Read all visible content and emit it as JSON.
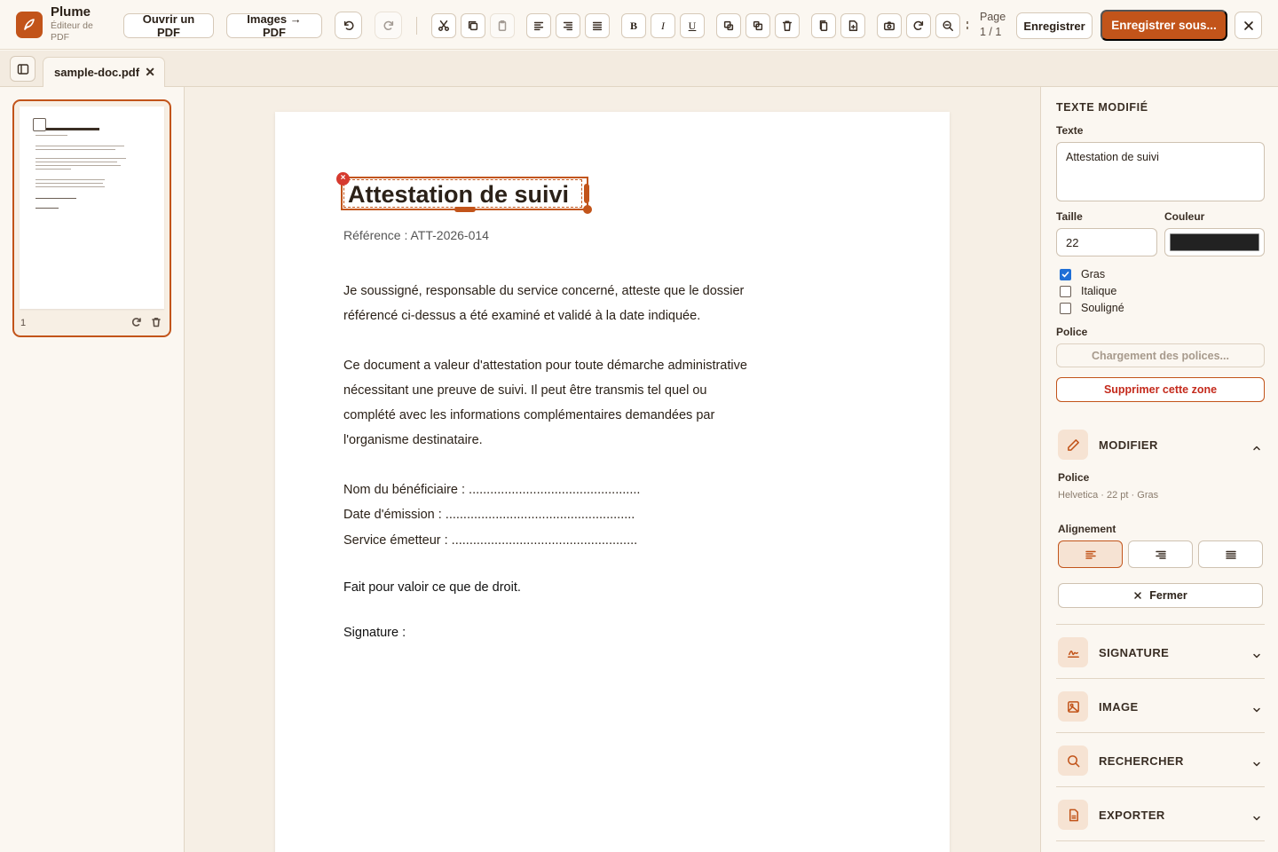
{
  "app": {
    "name": "Plume",
    "subtitle": "Éditeur de PDF"
  },
  "toolbar": {
    "open_pdf": "Ouvrir un PDF",
    "images_to_pdf": "Images → PDF",
    "bold_glyph": "B",
    "italic_glyph": "I",
    "underline_glyph": "U",
    "page_label": "Page",
    "page_value": "1 / 1",
    "save": "Enregistrer",
    "save_as": "Enregistrer sous..."
  },
  "tabs": [
    {
      "label": "sample-doc.pdf",
      "close": "✕"
    }
  ],
  "thumbnails": [
    {
      "page_number": "1"
    }
  ],
  "document": {
    "title": "Attestation de suivi",
    "reference": "Référence : ATT-2026-014",
    "para1_line1": "Je soussigné, responsable du service concerné, atteste que le dossier",
    "para1_line2": "référencé ci-dessus a été examiné et validé à la date indiquée.",
    "para2_line1": "Ce document a valeur d'attestation pour toute démarche administrative",
    "para2_line2": "nécessitant une preuve de suivi. Il peut être transmis tel quel ou",
    "para2_line3": "complété avec les informations complémentaires demandées par",
    "para2_line4": "l'organisme destinataire.",
    "field_beneficiary": "Nom du bénéficiaire : ................................................",
    "field_date": "Date d'émission : .....................................................",
    "field_service": "Service émetteur : ....................................................",
    "closing": "Fait pour valoir ce que de droit.",
    "signature": "Signature :"
  },
  "right_panel": {
    "heading": "TEXTE MODIFIÉ",
    "text_label": "Texte",
    "text_value": "Attestation de suivi",
    "size_label": "Taille",
    "size_value": "22",
    "color_label": "Couleur",
    "text_color": "#222222",
    "style_options": [
      {
        "label": "Gras",
        "checked": true
      },
      {
        "label": "Italique",
        "checked": false
      },
      {
        "label": "Souligné",
        "checked": false
      }
    ],
    "font_label": "Police",
    "font_loading": "Chargement des polices...",
    "delete_zone": "Supprimer cette zone",
    "sections": {
      "modifier": {
        "label": "MODIFIER",
        "expanded": true,
        "font_label": "Police",
        "font_summary": "Helvetica · 22 pt · Gras",
        "alignment_label": "Alignement",
        "alignment_selected": "left",
        "close_label": "Fermer"
      },
      "signature": {
        "label": "SIGNATURE"
      },
      "image": {
        "label": "IMAGE"
      },
      "search": {
        "label": "RECHERCHER"
      },
      "export": {
        "label": "EXPORTER"
      }
    }
  },
  "colors": {
    "accent": "#c2541a",
    "danger": "#c42a1c",
    "background": "#fbf7f1"
  }
}
